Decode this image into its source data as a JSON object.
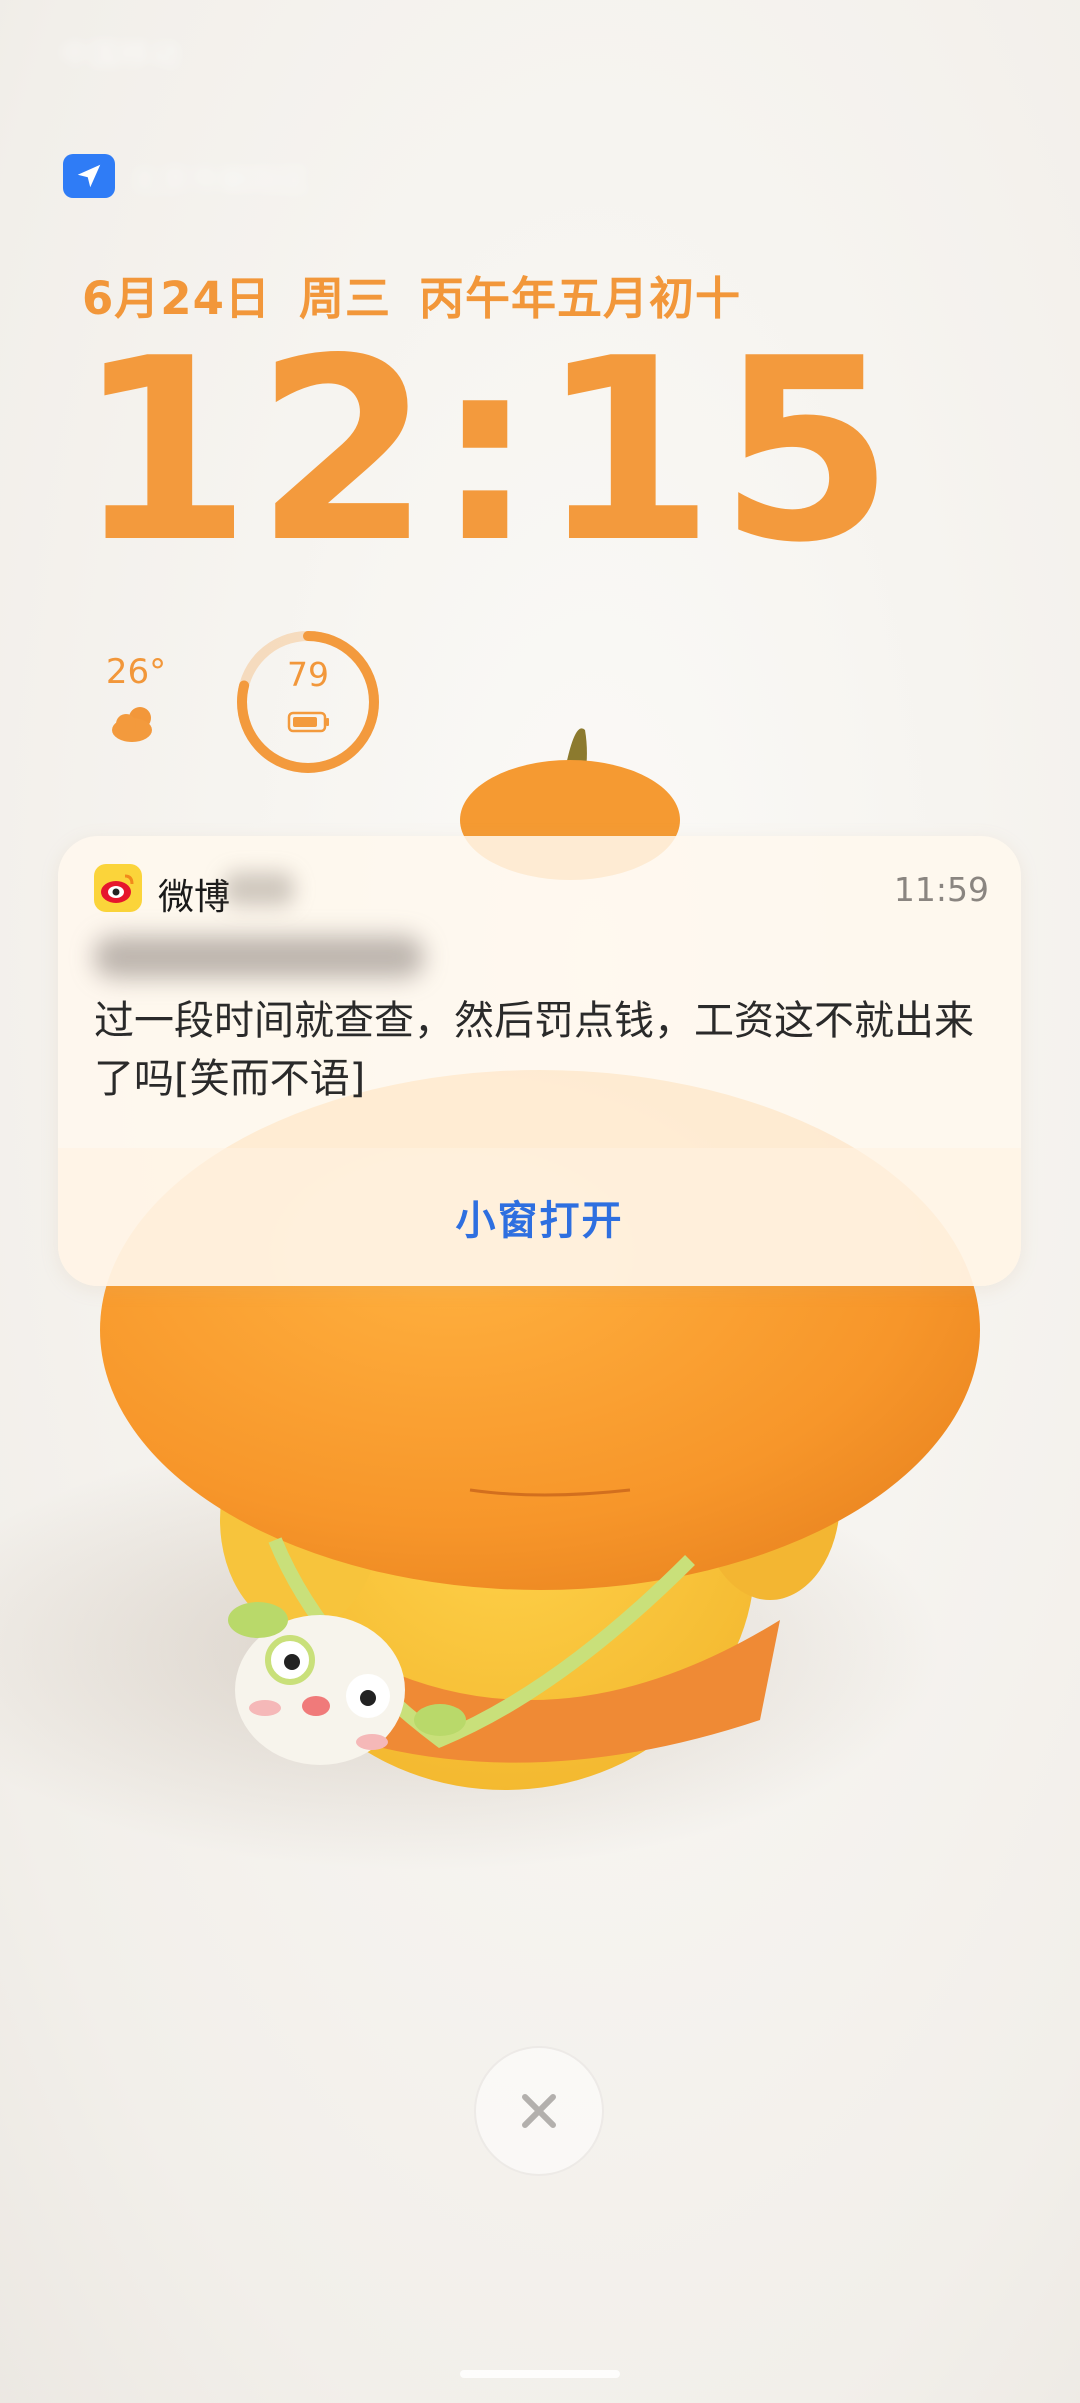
{
  "status_bar": {
    "left_text": "中国移动"
  },
  "location": {
    "icon": "navigation-arrow-icon",
    "text": "北京市朝阳区"
  },
  "lock_screen": {
    "date": "6月24日",
    "weekday": "周三",
    "lunar": "丙午年五月初十",
    "time": "12:15"
  },
  "weather": {
    "temperature": "26°",
    "icon": "sun-behind-cloud-icon"
  },
  "battery": {
    "level": 79,
    "label": "79",
    "icon": "battery-icon"
  },
  "notification": {
    "app_name": "微博",
    "time": "11:59",
    "sender": "",
    "message": "过一段时间就查查，然后罚点钱，工资这不就出来了吗[笑而不语]",
    "action_label": "小窗打开"
  },
  "colors": {
    "accent_orange": "#f39a3d",
    "link_blue": "#2e6fe0",
    "location_blue": "#2f7cf6",
    "weibo_yellow": "#fbd43a"
  },
  "close_button": {
    "icon": "close-x-icon"
  }
}
